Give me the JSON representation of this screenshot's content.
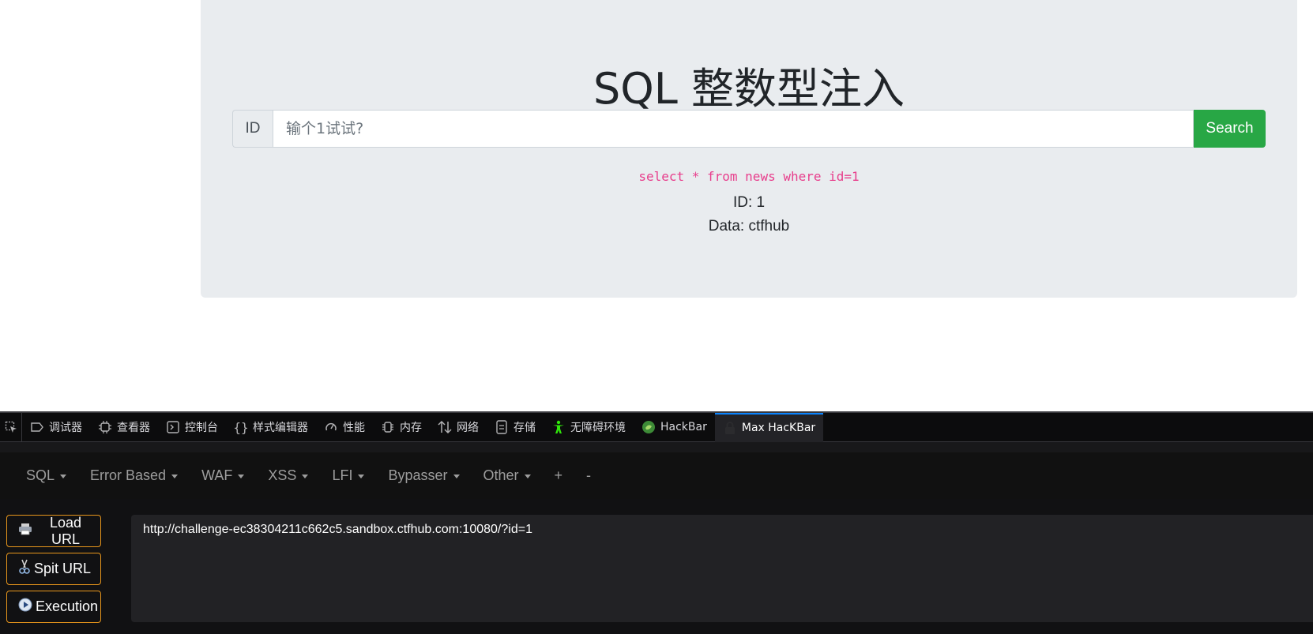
{
  "page": {
    "title": "SQL 整数型注入",
    "input_prefix": "ID",
    "input_placeholder": "输个1试试?",
    "search_label": "Search",
    "sql_query": "select * from news where id=1",
    "result_id": "ID: 1",
    "result_data": "Data: ctfhub",
    "accent_color": "#28a745",
    "query_color": "#e83e8c"
  },
  "devtools": {
    "tabs": [
      {
        "label": "调试器",
        "icon": "debugger-icon"
      },
      {
        "label": "查看器",
        "icon": "inspector-icon"
      },
      {
        "label": "控制台",
        "icon": "console-icon"
      },
      {
        "label": "样式编辑器",
        "icon": "style-editor-icon"
      },
      {
        "label": "性能",
        "icon": "performance-icon"
      },
      {
        "label": "内存",
        "icon": "memory-icon"
      },
      {
        "label": "网络",
        "icon": "network-icon"
      },
      {
        "label": "存储",
        "icon": "storage-icon"
      },
      {
        "label": "无障碍环境",
        "icon": "accessibility-icon"
      },
      {
        "label": "HackBar",
        "icon": "hackbar-icon"
      },
      {
        "label": "Max HacKBar",
        "icon": "lock-icon"
      }
    ],
    "active_tab": "Max HacKBar",
    "active_color": "#0a84ff"
  },
  "hackbar": {
    "menu": [
      "SQL",
      "Error Based",
      "WAF",
      "XSS",
      "LFI",
      "Bypasser",
      "Other",
      "+",
      "-"
    ],
    "buttons": {
      "load_url": "Load URL",
      "split_url": "Spit URL",
      "execution": "Execution"
    },
    "url": "http://challenge-ec38304211c662c5.sandbox.ctfhub.com:10080/?id=1",
    "button_border_color": "#e8961c"
  }
}
